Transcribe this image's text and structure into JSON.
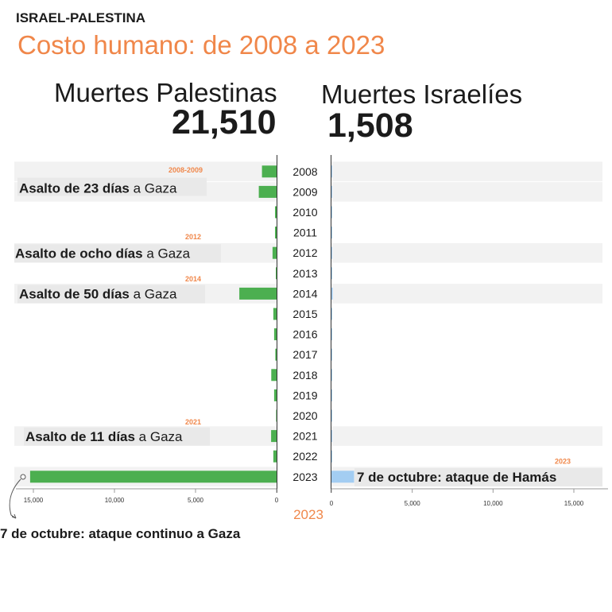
{
  "header": {
    "kicker": "ISRAEL-PALESTINA",
    "title": "Costo humano: de 2008 a 2023"
  },
  "panels": {
    "palestine": {
      "heading": "Muertes Palestinas",
      "total": "21,510"
    },
    "israel": {
      "heading": "Muertes Israelíes",
      "total": "1,508"
    }
  },
  "chart_data": {
    "type": "bar",
    "orientation": "horizontal, back-to-back",
    "categories": [
      "2008",
      "2009",
      "2010",
      "2011",
      "2012",
      "2013",
      "2014",
      "2015",
      "2016",
      "2017",
      "2018",
      "2019",
      "2020",
      "2021",
      "2022",
      "2023"
    ],
    "series": [
      {
        "name": "Muertes Palestinas",
        "color": "#4caf50",
        "direction": "left",
        "values": [
          900,
          1100,
          100,
          100,
          250,
          50,
          2300,
          200,
          150,
          80,
          330,
          150,
          30,
          340,
          200,
          15200
        ]
      },
      {
        "name": "Muertes Israelíes",
        "color": "#a3cdf2",
        "direction": "right",
        "values": [
          30,
          20,
          10,
          10,
          20,
          5,
          80,
          30,
          20,
          20,
          10,
          10,
          5,
          20,
          30,
          1400
        ]
      }
    ],
    "left_axis": {
      "range": [
        16500,
        0
      ],
      "ticks": [
        15000,
        10000,
        5000,
        0
      ],
      "tick_labels": [
        "15,000",
        "10,000",
        "5,000",
        "0"
      ]
    },
    "right_axis": {
      "range": [
        0,
        16500
      ],
      "ticks": [
        0,
        5000,
        10000,
        15000
      ],
      "tick_labels": [
        "0",
        "5,000",
        "10,000",
        "15,000"
      ]
    },
    "year_row_background": [
      "#f2f2f2",
      "#f2f2f2",
      "#ffffff",
      "#ffffff",
      "#f2f2f2",
      "#ffffff",
      "#f2f2f2",
      "#ffffff",
      "#ffffff",
      "#ffffff",
      "#ffffff",
      "#ffffff",
      "#ffffff",
      "#f2f2f2",
      "#ffffff",
      "#f2f2f2"
    ],
    "annotations": [
      {
        "year_tag": "2008-2009",
        "bold": "Asalto de 23 días",
        "rest": " a Gaza",
        "side": "left"
      },
      {
        "year_tag": "2012",
        "bold": "Asalto de ocho días",
        "rest": " a Gaza",
        "side": "left"
      },
      {
        "year_tag": "2014",
        "bold": "Asalto de 50 días",
        "rest": " a Gaza",
        "side": "left"
      },
      {
        "year_tag": "2021",
        "bold": "Asalto de 11 días",
        "rest": " a Gaza",
        "side": "left"
      },
      {
        "year_tag": "2023",
        "bold": "7 de octubre: ataque de Hamás",
        "rest": "",
        "side": "right"
      }
    ],
    "footer_year": "2023",
    "footer_note": "7 de octubre: ataque continuo a Gaza",
    "accent_color": "#f0874a"
  }
}
